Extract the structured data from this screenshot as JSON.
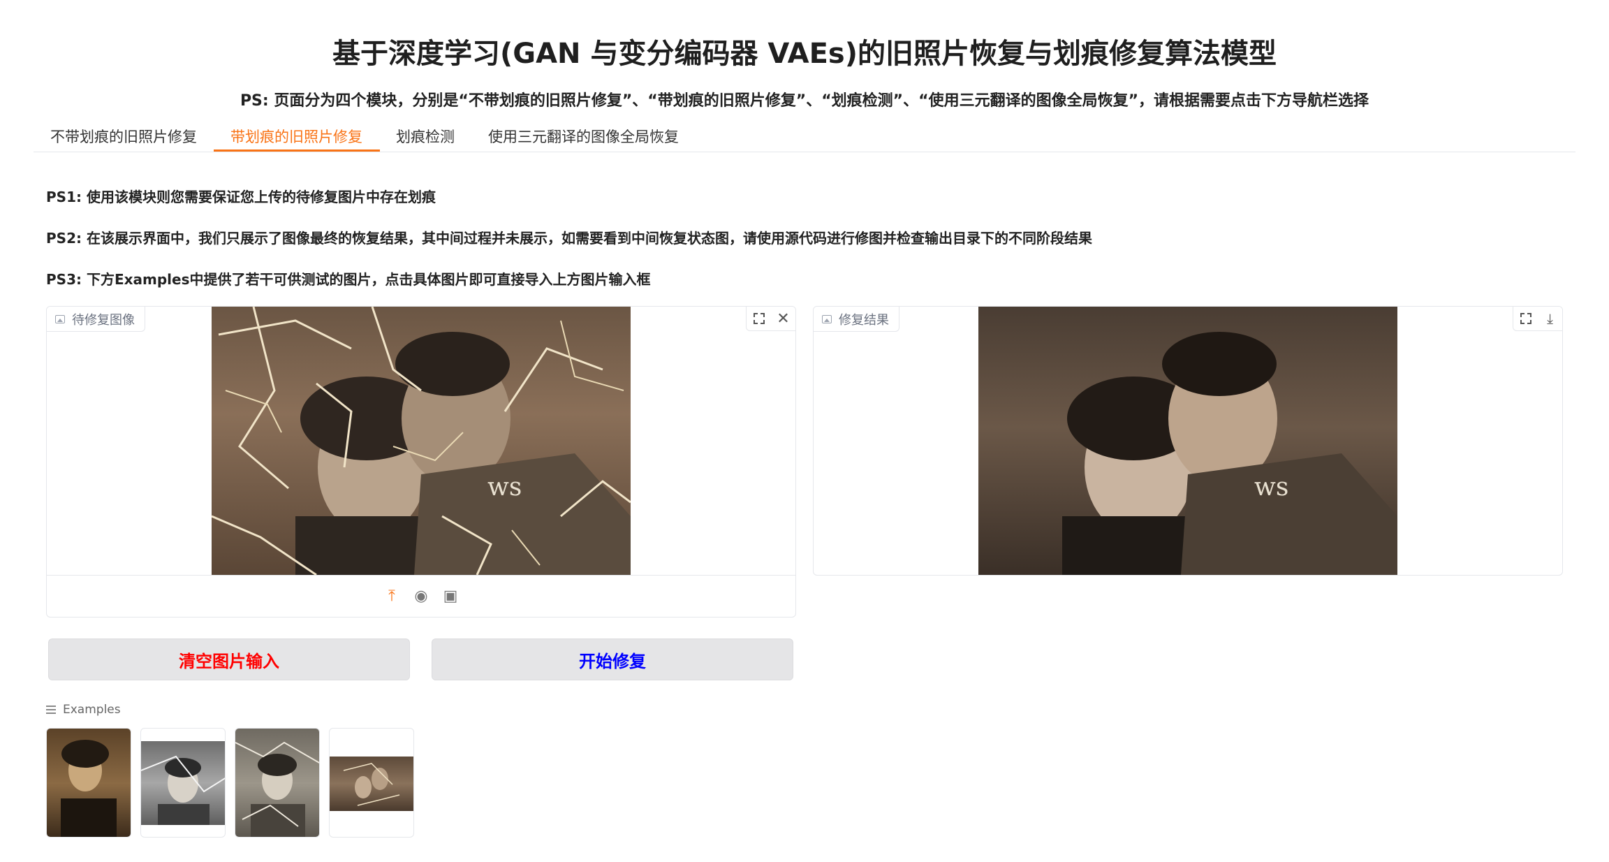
{
  "page": {
    "title": "基于深度学习(GAN 与变分编码器 VAEs)的旧照片恢复与划痕修复算法模型",
    "subtitle": "PS: 页面分为四个模块，分别是“不带划痕的旧照片修复”、“带划痕的旧照片修复”、“划痕检测”、“使用三元翻译的图像全局恢复”，请根据需要点击下方导航栏选择"
  },
  "tabs": [
    {
      "label": "不带划痕的旧照片修复",
      "active": false
    },
    {
      "label": "带划痕的旧照片修复",
      "active": true
    },
    {
      "label": "划痕检测",
      "active": false
    },
    {
      "label": "使用三元翻译的图像全局恢复",
      "active": false
    }
  ],
  "notes": [
    "PS1: 使用该模块则您需要保证您上传的待修复图片中存在划痕",
    "PS2: 在该展示界面中，我们只展示了图像最终的恢复结果，其中间过程并未展示，如需要看到中间恢复状态图，请使用源代码进行修图并检查输出目录下的不同阶段结果",
    "PS3: 下方Examples中提供了若干可供测试的图片，点击具体图片即可直接导入上方图片输入框"
  ],
  "input_panel": {
    "label": "待修复图像",
    "icons": [
      "fullscreen-icon",
      "close-icon",
      "upload-icon",
      "webcam-icon",
      "clipboard-icon"
    ]
  },
  "output_panel": {
    "label": "修复结果",
    "icons": [
      "fullscreen-icon",
      "download-icon"
    ]
  },
  "buttons": {
    "clear_label": "清空图片输入",
    "start_label": "开始修复"
  },
  "examples": {
    "label": "Examples",
    "count": 4
  },
  "colors": {
    "accent": "#f97316",
    "clear_text": "#ff0000",
    "start_text": "#0000ff",
    "button_bg": "#e5e5e7"
  }
}
